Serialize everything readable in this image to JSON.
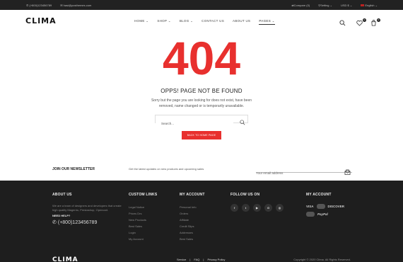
{
  "topbar": {
    "phone": "(+800)123456789",
    "email": "hasi@posthemes.com",
    "compare": "Compare (0)",
    "setting": "Setting",
    "currency": "USD $",
    "language": "English"
  },
  "header": {
    "logo": "CLIMA",
    "nav": [
      "HOME",
      "SHOP",
      "BLOG",
      "CONTACT US",
      "ABOUT US",
      "PAGES"
    ],
    "wishlist_count": "0",
    "cart_count": "0"
  },
  "error": {
    "code": "404",
    "title": "OPPS! PAGE NOT BE FOUND",
    "message": "Sorry but the page you are looking for does not exist, have been removed, name changed or is temporarily unavailable.",
    "search_placeholder": "Search...",
    "back_button": "BACK TO HOME PAGE"
  },
  "newsletter": {
    "title": "JOIN OUR NEWSLETTER",
    "description": "Get the latest updates on new products and upcoming sales",
    "placeholder": "Your email address"
  },
  "footer": {
    "about": {
      "heading": "ABOUT US",
      "text": "We are a team of designers and developers that create high quality Magento, Prestashop, Opencart.",
      "need_help": "NEED HELP?",
      "phone": "(+800)123456789"
    },
    "custom_links": {
      "heading": "CUSTOM LINKS",
      "items": [
        "Legal Notice",
        "Prices Drs",
        "New Products",
        "Best Sales",
        "Login",
        "My Account"
      ]
    },
    "my_account": {
      "heading": "MY ACCOUNT",
      "items": [
        "Personal Info",
        "Orders",
        "Affiliate",
        "Credit Slips",
        "Addresses",
        "Best Sales"
      ]
    },
    "follow": {
      "heading": "FOLLOW US ON",
      "icons": [
        "facebook-icon",
        "twitter-icon",
        "youtube-icon",
        "google-plus-icon",
        "instagram-icon"
      ]
    },
    "payment": {
      "heading": "MY ACCOUNT",
      "visa": "VISA",
      "discover": "DISCOVER",
      "paypal": "PayPal"
    },
    "bottom": {
      "logo": "CLIMA",
      "links": [
        "Service",
        "FAQ",
        "Privacy Policy"
      ],
      "copyright": "Copyright © 2020 Clima. All Rights Reserved."
    }
  },
  "colors": {
    "accent": "#e8302e",
    "footer_bg": "#1e1e1e",
    "topbar_bg": "#222222"
  }
}
